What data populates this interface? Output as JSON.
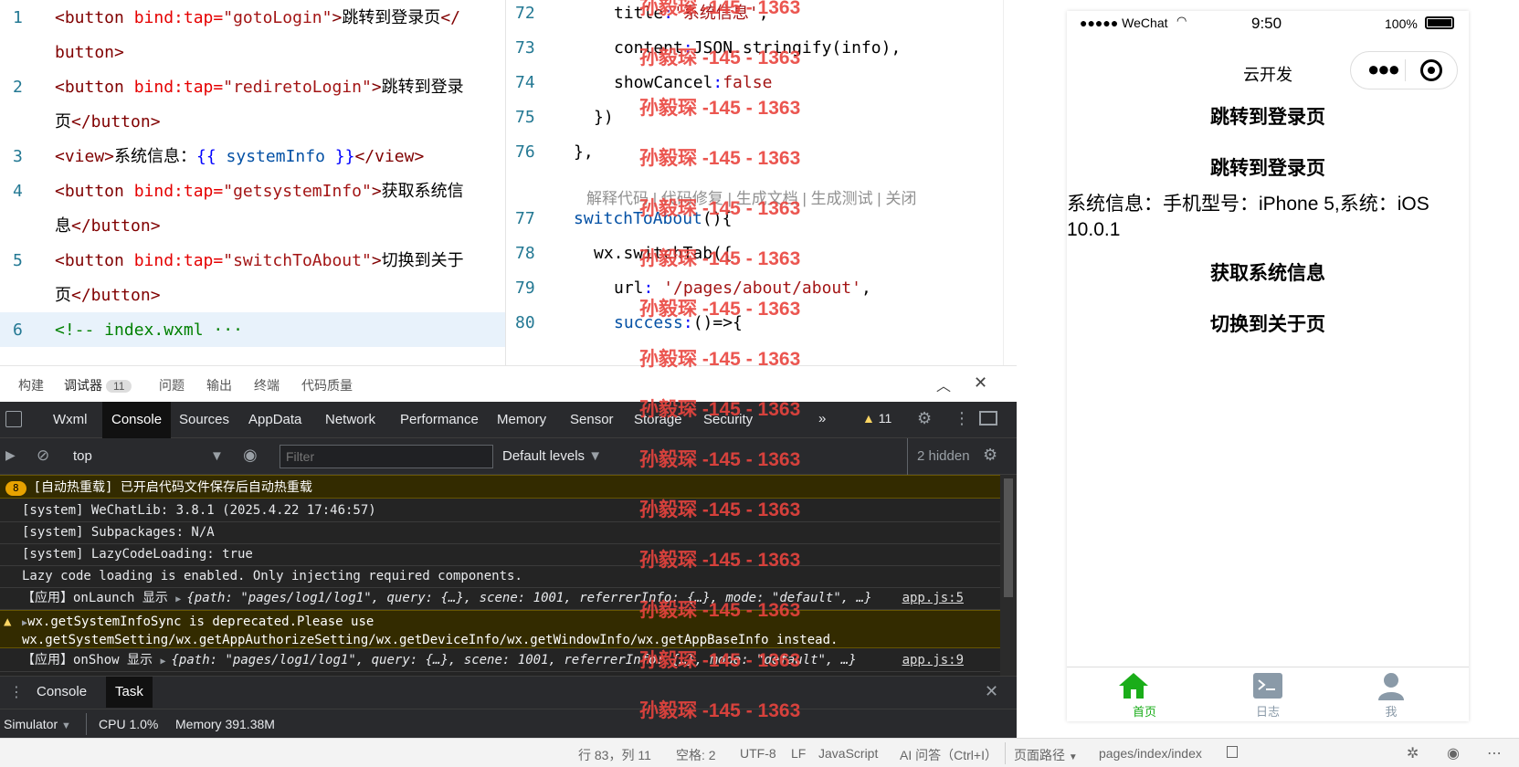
{
  "editor_left": {
    "lines": [
      {
        "num": "1",
        "segments": [
          [
            "tag",
            "<button "
          ],
          [
            "attr",
            "bind:tap="
          ],
          [
            "str",
            "\"gotoLogin\""
          ],
          [
            "tag",
            ">"
          ],
          [
            "txt",
            "跳转到登录页"
          ],
          [
            "tag",
            "</"
          ]
        ]
      },
      {
        "num": "",
        "segments": [
          [
            "tag",
            "button>"
          ]
        ]
      },
      {
        "num": "2",
        "segments": [
          [
            "tag",
            "<button "
          ],
          [
            "attr",
            "bind:tap="
          ],
          [
            "str",
            "\"rediretoLogin\""
          ],
          [
            "tag",
            ">"
          ],
          [
            "txt",
            "跳转到登录"
          ]
        ]
      },
      {
        "num": "",
        "segments": [
          [
            "txt",
            "页"
          ],
          [
            "tag",
            "</button>"
          ]
        ]
      },
      {
        "num": "3",
        "segments": [
          [
            "tag",
            "<view>"
          ],
          [
            "txt",
            "系统信息："
          ],
          [
            "kw",
            "{{ "
          ],
          [
            "attrv",
            "systemInfo"
          ],
          [
            "kw",
            " }}"
          ],
          [
            "tag",
            "</view>"
          ]
        ]
      },
      {
        "num": "4",
        "segments": [
          [
            "tag",
            "<button "
          ],
          [
            "attr",
            "bind:tap="
          ],
          [
            "str",
            "\"getsystemInfo\""
          ],
          [
            "tag",
            ">"
          ],
          [
            "txt",
            "获取系统信"
          ]
        ]
      },
      {
        "num": "",
        "segments": [
          [
            "txt",
            "息"
          ],
          [
            "tag",
            "</button>"
          ]
        ]
      },
      {
        "num": "5",
        "segments": [
          [
            "tag",
            "<button "
          ],
          [
            "attr",
            "bind:tap="
          ],
          [
            "str",
            "\"switchToAbout\""
          ],
          [
            "tag",
            ">"
          ],
          [
            "txt",
            "切换到关于"
          ]
        ]
      },
      {
        "num": "",
        "segments": [
          [
            "txt",
            "页"
          ],
          [
            "tag",
            "</button>"
          ]
        ]
      },
      {
        "num": "6",
        "segments": [
          [
            "cmt",
            "<!-- index.wxml ···"
          ]
        ]
      }
    ]
  },
  "editor_mid": {
    "lines": [
      {
        "num": "72",
        "segments": [
          [
            "txt",
            "title"
          ],
          [
            "kw",
            ":"
          ],
          [
            "str",
            "'系统信息'"
          ],
          [
            "txt",
            ","
          ]
        ],
        "indent": 3
      },
      {
        "num": "73",
        "segments": [
          [
            "txt",
            "content"
          ],
          [
            "kw",
            ":"
          ],
          [
            "txt",
            "JSON.stringify(info),"
          ]
        ],
        "indent": 3
      },
      {
        "num": "74",
        "segments": [
          [
            "txt",
            "showCancel"
          ],
          [
            "kw",
            ":"
          ],
          [
            "str",
            "false"
          ]
        ],
        "indent": 3
      },
      {
        "num": "75",
        "segments": [
          [
            "txt",
            "})"
          ]
        ],
        "indent": 2
      },
      {
        "num": "76",
        "segments": [
          [
            "txt",
            "},"
          ]
        ],
        "indent": 1
      },
      {
        "num": "77",
        "segments": [
          [
            "attrv",
            "switchToAbout"
          ],
          [
            "txt",
            "(){"
          ]
        ],
        "indent": 1
      },
      {
        "num": "78",
        "segments": [
          [
            "txt",
            "wx.switchTab({"
          ]
        ],
        "indent": 2
      },
      {
        "num": "79",
        "segments": [
          [
            "txt",
            "url"
          ],
          [
            "kw",
            ": "
          ],
          [
            "str",
            "'/pages/about/about'"
          ],
          [
            "txt",
            ","
          ]
        ],
        "indent": 3
      },
      {
        "num": "80",
        "segments": [
          [
            "attrv",
            "success"
          ],
          [
            "kw",
            ":"
          ],
          [
            "txt",
            "()=>{"
          ]
        ],
        "indent": 3
      }
    ],
    "codelens": "解释代码 | 代码修复 | 生成文档 | 生成测试 | 关闭"
  },
  "panel_tabs": {
    "items": [
      "构建",
      "调试器",
      "问题",
      "输出",
      "终端",
      "代码质量"
    ],
    "debugger_badge": "11"
  },
  "devtools_tabs": [
    "Wxml",
    "Console",
    "Sources",
    "AppData",
    "Network",
    "Performance",
    "Memory",
    "Sensor",
    "Storage",
    "Security"
  ],
  "devtools_more": "»",
  "devtools_warn_count": "11",
  "filter": {
    "context": "top",
    "placeholder": "Filter",
    "levels": "Default levels",
    "hidden": "2 hidden"
  },
  "console_rows": [
    {
      "kind": "warn-badge",
      "badge": "8",
      "text": "[自动热重载] 已开启代码文件保存后自动热重载"
    },
    {
      "kind": "log",
      "text": "[system] WeChatLib: 3.8.1 (2025.4.22 17:46:57)"
    },
    {
      "kind": "log",
      "text": "[system] Subpackages: N/A"
    },
    {
      "kind": "log",
      "text": "[system] LazyCodeLoading: true"
    },
    {
      "kind": "log",
      "text": "Lazy code loading is enabled. Only injecting required components."
    },
    {
      "kind": "obj",
      "prefix": "【应用】onLaunch 显示 ",
      "obj": "{path: \"pages/log1/log1\", query: {…}, scene: 1001, referrerInfo: {…}, mode: \"default\", …}",
      "link": "app.js:5"
    },
    {
      "kind": "warn",
      "text": "wx.getSystemInfoSync is deprecated.Please use",
      "text2": "wx.getSystemSetting/wx.getAppAuthorizeSetting/wx.getDeviceInfo/wx.getWindowInfo/wx.getAppBaseInfo instead."
    },
    {
      "kind": "obj",
      "prefix": "【应用】onShow 显示 ",
      "obj": "{path: \"pages/log1/log1\", query: {…}, scene: 1001, referrerInfo: {…}, mode: \"default\", …}",
      "link": "app.js:9"
    }
  ],
  "bottom_tabs": [
    "Console",
    "Task"
  ],
  "sim_bar": {
    "simulator": "Simulator",
    "cpu": "CPU 1.0%",
    "memory": "Memory 391.38M"
  },
  "status_bar": {
    "position": "行 83，列 11",
    "spaces": "空格: 2",
    "encoding": "UTF-8",
    "eol": "LF",
    "language": "JavaScript",
    "ai": "AI 问答（Ctrl+I）",
    "page_path_label": "页面路径",
    "page_path": "pages/index/index"
  },
  "phone": {
    "carrier": "●●●●● WeChat",
    "time": "9:50",
    "battery": "100%",
    "nav_title": "云开发",
    "buttons": [
      "跳转到登录页",
      "跳转到登录页"
    ],
    "system_info": "系统信息：手机型号：iPhone 5,系统：iOS 10.0.1",
    "buttons2": [
      "获取系统信息",
      "切换到关于页"
    ],
    "tabbar": [
      {
        "label": "首页",
        "icon": "home-icon",
        "active": true
      },
      {
        "label": "日志",
        "icon": "terminal-icon",
        "active": false
      },
      {
        "label": "我",
        "icon": "user-icon",
        "active": false
      }
    ],
    "accent": "#1aad19"
  },
  "watermark": "孙毅琛 -145 - 1363"
}
